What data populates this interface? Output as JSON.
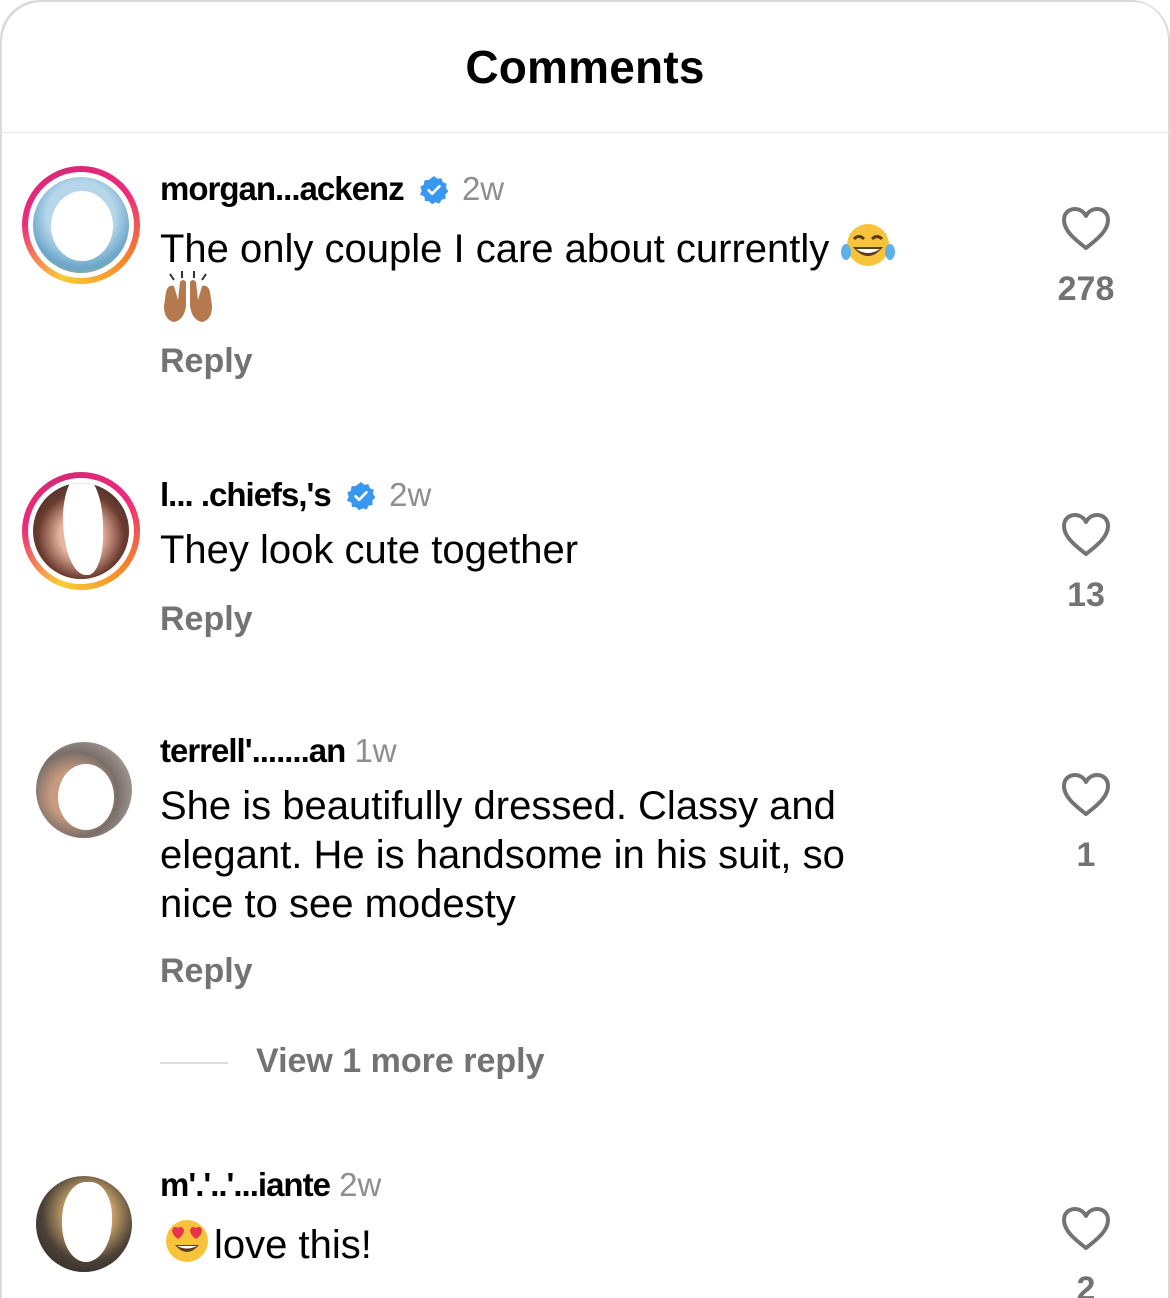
{
  "header": {
    "title": "Comments"
  },
  "comments": [
    {
      "username": "morgan...ackenz",
      "time": "2w",
      "text": "The only couple I care about currently",
      "emoji": "😂",
      "second_line_emoji": "🙌🏽",
      "reply_label": "Reply",
      "likes": "278"
    },
    {
      "username": "l... .chiefs,'s",
      "time": "2w",
      "text": "They look cute together",
      "reply_label": "Reply",
      "likes": "13"
    },
    {
      "username": "terrell'.......an",
      "time": "1w",
      "text_lines": [
        "She is beautifully dressed. Classy and",
        "elegant. He is  handsome in his suit, so",
        "nice to see modesty"
      ],
      "reply_label": "Reply",
      "likes": "1",
      "view_more": "View 1 more reply"
    },
    {
      "username": "m'.'..'...iante",
      "time": "2w",
      "emoji": "😍",
      "text": "love this!",
      "likes": "2"
    }
  ],
  "colors": {
    "ring_start": "#f9ce34",
    "ring_mid": "#ee2a7b",
    "verified": "#3897f0",
    "secondary_text": "#737373"
  }
}
